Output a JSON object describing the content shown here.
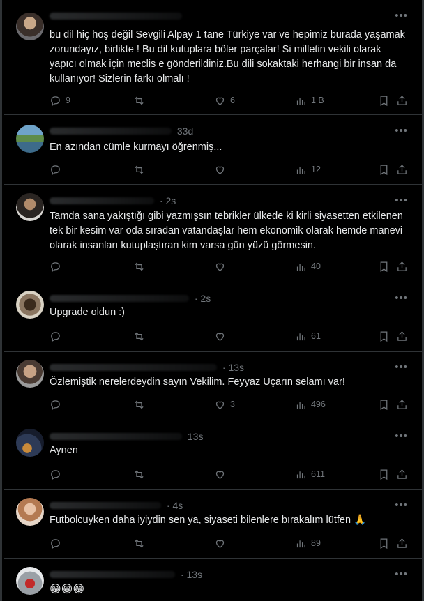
{
  "tweets": [
    {
      "time": "",
      "text": "bu dil hiç hoş değil Sevgili Alpay 1 tane Türkiye var ve hepimiz burada yaşamak zorundayız, birlikte ! Bu dil kutuplara böler parçalar! Si milletin vekili olarak yapıcı olmak için meclis e gönderildiniz.Bu dili sokaktaki herhangi bir insan da kullanıyor! Sizlerin farkı olmalı !",
      "replies": "9",
      "retweets": "",
      "likes": "6",
      "views": "1 B"
    },
    {
      "time": "33d",
      "text": "En azından cümle kurmayı öğrenmiş...",
      "replies": "",
      "retweets": "",
      "likes": "",
      "views": "12"
    },
    {
      "time": "· 2s",
      "text": "Tamda sana yakıştığı gibi yazmışsın tebrikler ülkede ki kirli siyasetten etkilenen tek bir kesim var oda sıradan vatandaşlar hem ekonomik olarak hemde manevi olarak insanları kutuplaştıran kim varsa gün yüzü görmesin.",
      "replies": "",
      "retweets": "",
      "likes": "",
      "views": "40"
    },
    {
      "time": "· 2s",
      "text": "Upgrade oldun :)",
      "replies": "",
      "retweets": "",
      "likes": "",
      "views": "61"
    },
    {
      "time": "· 13s",
      "text": "Özlemiştik nerelerdeydin sayın Vekilim. Feyyaz Uçarın selamı var!",
      "replies": "",
      "retweets": "",
      "likes": "3",
      "views": "496"
    },
    {
      "time": "13s",
      "text": "Aynen",
      "replies": "",
      "retweets": "",
      "likes": "",
      "views": "611"
    },
    {
      "time": "· 4s",
      "text": "Futbolcuyken daha iyiydin sen ya, siyaseti bilenlere bırakalım lütfen 🙏",
      "replies": "",
      "retweets": "",
      "likes": "",
      "views": "89"
    },
    {
      "time": "· 13s",
      "text": "😁😁😁",
      "replies": "",
      "retweets": "",
      "likes": "",
      "views": ""
    }
  ],
  "more_label": "•••",
  "icons": {
    "reply": "reply-icon",
    "retweet": "retweet-icon",
    "like": "like-icon",
    "views": "views-icon",
    "bookmark": "bookmark-icon",
    "share": "share-icon"
  }
}
